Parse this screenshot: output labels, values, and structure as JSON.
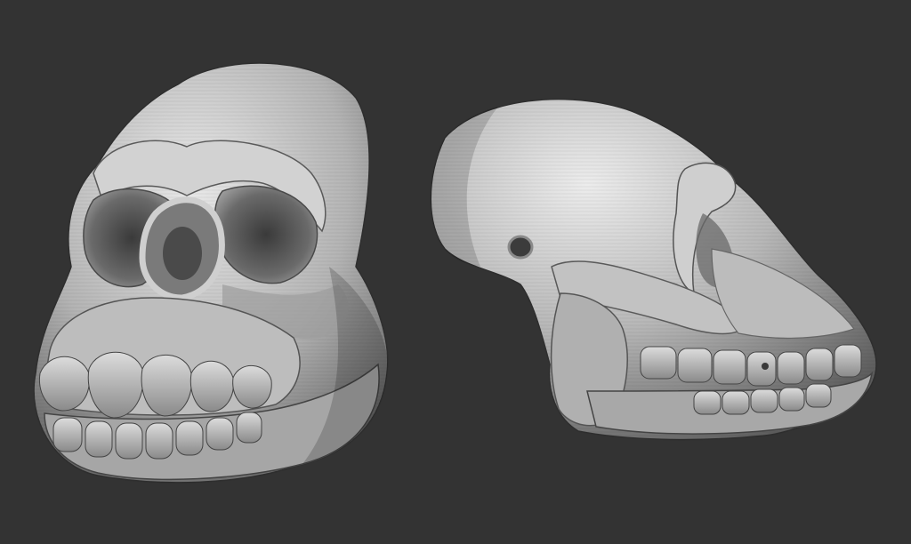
{
  "viewport": {
    "background": "#333333"
  },
  "models": [
    {
      "view": "three-quarter-front"
    },
    {
      "view": "side-profile"
    }
  ],
  "material": {
    "base": "#a9a9a9",
    "highlight": "#e8e8e8",
    "shadow": "#454545"
  }
}
